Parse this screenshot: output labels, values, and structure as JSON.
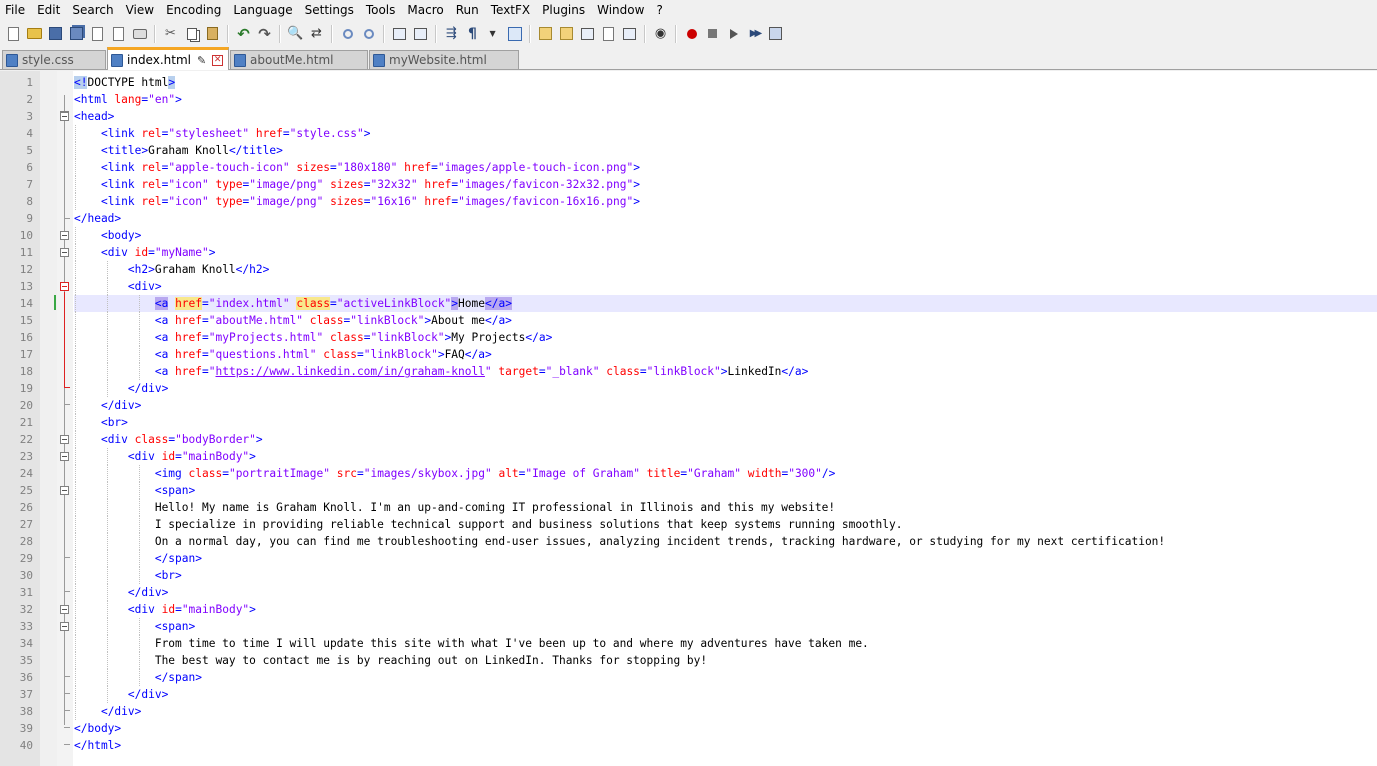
{
  "menu": [
    "File",
    "Edit",
    "Search",
    "View",
    "Encoding",
    "Language",
    "Settings",
    "Tools",
    "Macro",
    "Run",
    "TextFX",
    "Plugins",
    "Window",
    "?"
  ],
  "tabs": [
    {
      "label": "style.css",
      "active": false
    },
    {
      "label": "index.html",
      "active": true
    },
    {
      "label": "aboutMe.html",
      "active": false
    },
    {
      "label": "myWebsite.html",
      "active": false
    }
  ],
  "toolbar_icons": [
    "new-file-icon",
    "open-folder-icon",
    "save-icon",
    "save-all-icon",
    "close-icon",
    "close-all-icon",
    "print-icon",
    "cut-icon",
    "copy-icon",
    "paste-icon",
    "undo-icon",
    "redo-icon",
    "find-icon",
    "replace-icon",
    "zoom-in-icon",
    "zoom-out-icon",
    "sync-vertical-icon",
    "sync-horizontal-icon",
    "word-wrap-icon",
    "show-all-chars-icon",
    "indent-guide-icon",
    "user-lang-icon",
    "doc-map-icon",
    "function-list-icon",
    "folder-workspace-icon",
    "monitor-icon",
    "record-macro-icon",
    "stop-record-icon",
    "play-macro-icon",
    "run-macro-multiple-icon",
    "save-macro-icon"
  ],
  "editor": {
    "current_line": 14,
    "lines": [
      {
        "n": "1",
        "indent": 0,
        "tokens": [
          [
            "hlb",
            "<!"
          ],
          [
            "doc",
            "DOCTYPE html"
          ],
          [
            "hlb",
            ">"
          ]
        ]
      },
      {
        "n": "2",
        "indent": 0,
        "tokens": [
          [
            "tag",
            "<html "
          ],
          [
            "attr",
            "lang"
          ],
          [
            "tag",
            "="
          ],
          [
            "val",
            "\"en\""
          ],
          [
            "tag",
            ">"
          ]
        ]
      },
      {
        "n": "3",
        "indent": 0,
        "tokens": [
          [
            "tag",
            "<head>"
          ]
        ]
      },
      {
        "n": "4",
        "indent": 1,
        "tokens": [
          [
            "tag",
            "<link "
          ],
          [
            "attr",
            "rel"
          ],
          [
            "tag",
            "="
          ],
          [
            "val",
            "\"stylesheet\""
          ],
          [
            "txt",
            " "
          ],
          [
            "attr",
            "href"
          ],
          [
            "tag",
            "="
          ],
          [
            "val",
            "\"style.css\""
          ],
          [
            "tag",
            ">"
          ]
        ]
      },
      {
        "n": "5",
        "indent": 1,
        "tokens": [
          [
            "tag",
            "<title>"
          ],
          [
            "txt",
            "Graham Knoll"
          ],
          [
            "tag",
            "</title>"
          ]
        ]
      },
      {
        "n": "6",
        "indent": 1,
        "tokens": [
          [
            "tag",
            "<link "
          ],
          [
            "attr",
            "rel"
          ],
          [
            "tag",
            "="
          ],
          [
            "val",
            "\"apple-touch-icon\""
          ],
          [
            "txt",
            " "
          ],
          [
            "attr",
            "sizes"
          ],
          [
            "tag",
            "="
          ],
          [
            "val",
            "\"180x180\""
          ],
          [
            "txt",
            " "
          ],
          [
            "attr",
            "href"
          ],
          [
            "tag",
            "="
          ],
          [
            "val",
            "\"images/apple-touch-icon.png\""
          ],
          [
            "tag",
            ">"
          ]
        ]
      },
      {
        "n": "7",
        "indent": 1,
        "tokens": [
          [
            "tag",
            "<link "
          ],
          [
            "attr",
            "rel"
          ],
          [
            "tag",
            "="
          ],
          [
            "val",
            "\"icon\""
          ],
          [
            "txt",
            " "
          ],
          [
            "attr",
            "type"
          ],
          [
            "tag",
            "="
          ],
          [
            "val",
            "\"image/png\""
          ],
          [
            "txt",
            " "
          ],
          [
            "attr",
            "sizes"
          ],
          [
            "tag",
            "="
          ],
          [
            "val",
            "\"32x32\""
          ],
          [
            "txt",
            " "
          ],
          [
            "attr",
            "href"
          ],
          [
            "tag",
            "="
          ],
          [
            "val",
            "\"images/favicon-32x32.png\""
          ],
          [
            "tag",
            ">"
          ]
        ]
      },
      {
        "n": "8",
        "indent": 1,
        "tokens": [
          [
            "tag",
            "<link "
          ],
          [
            "attr",
            "rel"
          ],
          [
            "tag",
            "="
          ],
          [
            "val",
            "\"icon\""
          ],
          [
            "txt",
            " "
          ],
          [
            "attr",
            "type"
          ],
          [
            "tag",
            "="
          ],
          [
            "val",
            "\"image/png\""
          ],
          [
            "txt",
            " "
          ],
          [
            "attr",
            "sizes"
          ],
          [
            "tag",
            "="
          ],
          [
            "val",
            "\"16x16\""
          ],
          [
            "txt",
            " "
          ],
          [
            "attr",
            "href"
          ],
          [
            "tag",
            "="
          ],
          [
            "val",
            "\"images/favicon-16x16.png\""
          ],
          [
            "tag",
            ">"
          ]
        ]
      },
      {
        "n": "9",
        "indent": 0,
        "tokens": [
          [
            "tag",
            "</head>"
          ]
        ]
      },
      {
        "n": "10",
        "indent": 1,
        "tokens": [
          [
            "tag",
            "<body>"
          ]
        ]
      },
      {
        "n": "11",
        "indent": 1,
        "tokens": [
          [
            "tag",
            "<div "
          ],
          [
            "attr",
            "id"
          ],
          [
            "tag",
            "="
          ],
          [
            "val",
            "\"myName\""
          ],
          [
            "tag",
            ">"
          ]
        ]
      },
      {
        "n": "12",
        "indent": 2,
        "tokens": [
          [
            "tag",
            "<h2>"
          ],
          [
            "txt",
            "Graham Knoll"
          ],
          [
            "tag",
            "</h2>"
          ]
        ]
      },
      {
        "n": "13",
        "indent": 2,
        "tokens": [
          [
            "tag",
            "<div>"
          ]
        ]
      },
      {
        "n": "14",
        "indent": 3,
        "tokens": [
          [
            "hlt",
            "<a"
          ],
          [
            "txt",
            " "
          ],
          [
            "hla",
            "href"
          ],
          [
            "tag",
            "="
          ],
          [
            "val",
            "\"index.html\""
          ],
          [
            "txt",
            " "
          ],
          [
            "hla",
            "class"
          ],
          [
            "tag",
            "="
          ],
          [
            "val",
            "\"activeLinkBlock\""
          ],
          [
            "hlt",
            ">"
          ],
          [
            "txt",
            "Home"
          ],
          [
            "hlt",
            "</a>"
          ]
        ]
      },
      {
        "n": "15",
        "indent": 3,
        "tokens": [
          [
            "tag",
            "<a "
          ],
          [
            "attr",
            "href"
          ],
          [
            "tag",
            "="
          ],
          [
            "val",
            "\"aboutMe.html\""
          ],
          [
            "txt",
            " "
          ],
          [
            "attr",
            "class"
          ],
          [
            "tag",
            "="
          ],
          [
            "val",
            "\"linkBlock\""
          ],
          [
            "tag",
            ">"
          ],
          [
            "txt",
            "About me"
          ],
          [
            "tag",
            "</a>"
          ]
        ]
      },
      {
        "n": "16",
        "indent": 3,
        "tokens": [
          [
            "tag",
            "<a "
          ],
          [
            "attr",
            "href"
          ],
          [
            "tag",
            "="
          ],
          [
            "val",
            "\"myProjects.html\""
          ],
          [
            "txt",
            " "
          ],
          [
            "attr",
            "class"
          ],
          [
            "tag",
            "="
          ],
          [
            "val",
            "\"linkBlock\""
          ],
          [
            "tag",
            ">"
          ],
          [
            "txt",
            "My Projects"
          ],
          [
            "tag",
            "</a>"
          ]
        ]
      },
      {
        "n": "17",
        "indent": 3,
        "tokens": [
          [
            "tag",
            "<a "
          ],
          [
            "attr",
            "href"
          ],
          [
            "tag",
            "="
          ],
          [
            "val",
            "\"questions.html\""
          ],
          [
            "txt",
            " "
          ],
          [
            "attr",
            "class"
          ],
          [
            "tag",
            "="
          ],
          [
            "val",
            "\"linkBlock\""
          ],
          [
            "tag",
            ">"
          ],
          [
            "txt",
            "FAQ"
          ],
          [
            "tag",
            "</a>"
          ]
        ]
      },
      {
        "n": "18",
        "indent": 3,
        "tokens": [
          [
            "tag",
            "<a "
          ],
          [
            "attr",
            "href"
          ],
          [
            "tag",
            "="
          ],
          [
            "val",
            "\""
          ],
          [
            "url",
            "https://www.linkedin.com/in/graham-knoll"
          ],
          [
            "val",
            "\""
          ],
          [
            "txt",
            " "
          ],
          [
            "attr",
            "target"
          ],
          [
            "tag",
            "="
          ],
          [
            "val",
            "\"_blank\""
          ],
          [
            "txt",
            " "
          ],
          [
            "attr",
            "class"
          ],
          [
            "tag",
            "="
          ],
          [
            "val",
            "\"linkBlock\""
          ],
          [
            "tag",
            ">"
          ],
          [
            "txt",
            "LinkedIn"
          ],
          [
            "tag",
            "</a>"
          ]
        ]
      },
      {
        "n": "19",
        "indent": 2,
        "tokens": [
          [
            "tag",
            "</div>"
          ]
        ]
      },
      {
        "n": "20",
        "indent": 1,
        "tokens": [
          [
            "tag",
            "</div>"
          ]
        ]
      },
      {
        "n": "21",
        "indent": 1,
        "tokens": [
          [
            "tag",
            "<br>"
          ]
        ]
      },
      {
        "n": "22",
        "indent": 1,
        "tokens": [
          [
            "tag",
            "<div "
          ],
          [
            "attr",
            "class"
          ],
          [
            "tag",
            "="
          ],
          [
            "val",
            "\"bodyBorder\""
          ],
          [
            "tag",
            ">"
          ]
        ]
      },
      {
        "n": "23",
        "indent": 2,
        "tokens": [
          [
            "tag",
            "<div "
          ],
          [
            "attr",
            "id"
          ],
          [
            "tag",
            "="
          ],
          [
            "val",
            "\"mainBody\""
          ],
          [
            "tag",
            ">"
          ]
        ]
      },
      {
        "n": "24",
        "indent": 3,
        "tokens": [
          [
            "tag",
            "<img "
          ],
          [
            "attr",
            "class"
          ],
          [
            "tag",
            "="
          ],
          [
            "val",
            "\"portraitImage\""
          ],
          [
            "txt",
            " "
          ],
          [
            "attr",
            "src"
          ],
          [
            "tag",
            "="
          ],
          [
            "val",
            "\"images/skybox.jpg\""
          ],
          [
            "txt",
            " "
          ],
          [
            "attr",
            "alt"
          ],
          [
            "tag",
            "="
          ],
          [
            "val",
            "\"Image of Graham\""
          ],
          [
            "txt",
            " "
          ],
          [
            "attr",
            "title"
          ],
          [
            "tag",
            "="
          ],
          [
            "val",
            "\"Graham\""
          ],
          [
            "txt",
            " "
          ],
          [
            "attr",
            "width"
          ],
          [
            "tag",
            "="
          ],
          [
            "val",
            "\"300\""
          ],
          [
            "tag",
            "/>"
          ]
        ]
      },
      {
        "n": "25",
        "indent": 3,
        "tokens": [
          [
            "tag",
            "<span>"
          ]
        ]
      },
      {
        "n": "26",
        "indent": 3,
        "tokens": [
          [
            "txt",
            "Hello! My name is Graham Knoll. I'm an up-and-coming IT professional in Illinois and this my website!"
          ]
        ]
      },
      {
        "n": "27",
        "indent": 3,
        "tokens": [
          [
            "txt",
            "I specialize in providing reliable technical support and business solutions that keep systems running smoothly."
          ]
        ]
      },
      {
        "n": "28",
        "indent": 3,
        "tokens": [
          [
            "txt",
            "On a normal day, you can find me troubleshooting end-user issues, analyzing incident trends, tracking hardware, or studying for my next certification!"
          ]
        ]
      },
      {
        "n": "29",
        "indent": 3,
        "tokens": [
          [
            "tag",
            "</span>"
          ]
        ]
      },
      {
        "n": "30",
        "indent": 3,
        "tokens": [
          [
            "tag",
            "<br>"
          ]
        ]
      },
      {
        "n": "31",
        "indent": 2,
        "tokens": [
          [
            "tag",
            "</div>"
          ]
        ]
      },
      {
        "n": "32",
        "indent": 2,
        "tokens": [
          [
            "tag",
            "<div "
          ],
          [
            "attr",
            "id"
          ],
          [
            "tag",
            "="
          ],
          [
            "val",
            "\"mainBody\""
          ],
          [
            "tag",
            ">"
          ]
        ]
      },
      {
        "n": "33",
        "indent": 3,
        "tokens": [
          [
            "tag",
            "<span>"
          ]
        ]
      },
      {
        "n": "34",
        "indent": 3,
        "tokens": [
          [
            "txt",
            "From time to time I will update this site with what I've been up to and where my adventures have taken me."
          ]
        ]
      },
      {
        "n": "35",
        "indent": 3,
        "tokens": [
          [
            "txt",
            "The best way to contact me is by reaching out on LinkedIn. Thanks for stopping by!"
          ]
        ]
      },
      {
        "n": "36",
        "indent": 3,
        "tokens": [
          [
            "tag",
            "</span>"
          ]
        ]
      },
      {
        "n": "37",
        "indent": 2,
        "tokens": [
          [
            "tag",
            "</div>"
          ]
        ]
      },
      {
        "n": "38",
        "indent": 1,
        "tokens": [
          [
            "tag",
            "</div>"
          ]
        ]
      },
      {
        "n": "39",
        "indent": 0,
        "tokens": [
          [
            "tag",
            "</body>"
          ]
        ]
      },
      {
        "n": "40",
        "indent": 0,
        "tokens": [
          [
            "tag",
            "</html>"
          ]
        ]
      }
    ]
  }
}
